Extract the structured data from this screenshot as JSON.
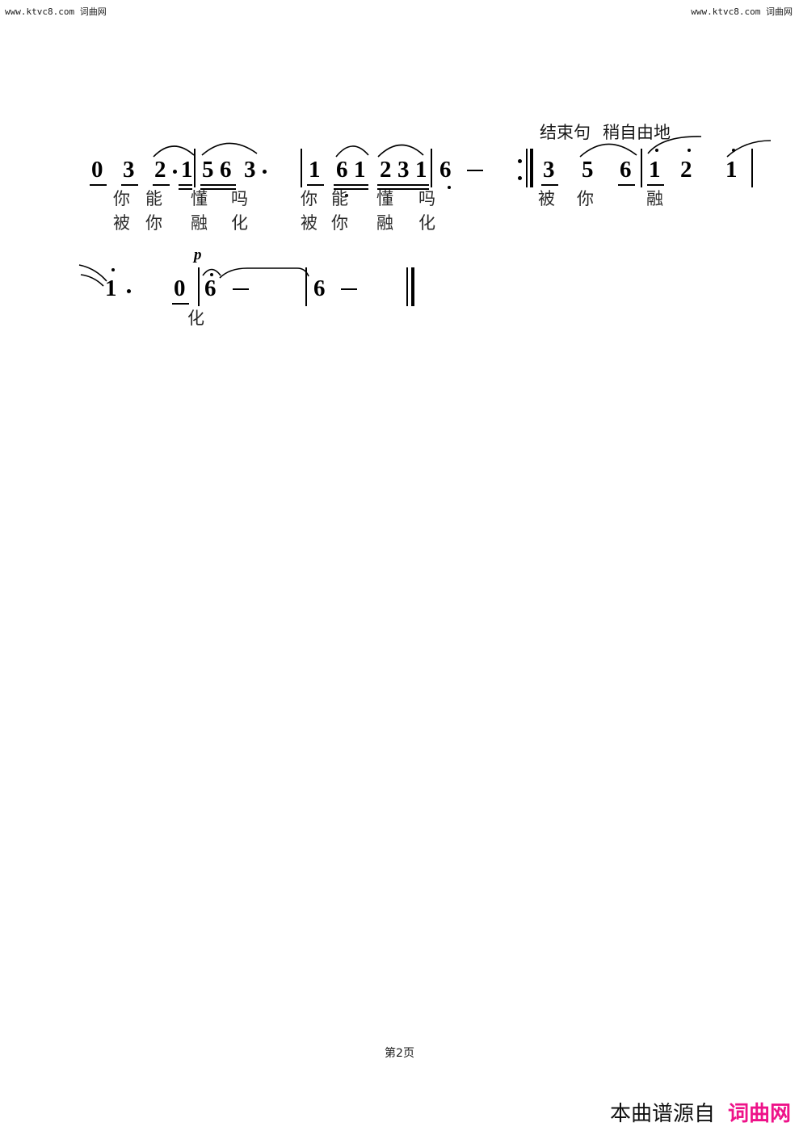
{
  "watermark": {
    "url": "www.ktvc8.com",
    "site": "词曲网",
    "left_text": "www.ktvc8.com 词曲网",
    "right_text": "www.ktvc8.com 词曲网"
  },
  "footer": {
    "page_number": "第2页",
    "source_label": "本曲谱源自",
    "source_site": "词曲网",
    "source_site_color": "#EE1289"
  },
  "annotations": {
    "ending_phrase": "结束句",
    "tempo_direction": "稍自由地",
    "dynamic_p": "p"
  },
  "chart_data": {
    "type": "table",
    "title": "简谱 第2页 (Jianpu numbered musical notation, page 2)",
    "notation": "jianpu",
    "systems": [
      {
        "index": 1,
        "measures": [
          {
            "index": 1,
            "notes": [
              {
                "pitch": "0",
                "beams": 1,
                "octave": 0,
                "dotted": false
              },
              {
                "pitch": "3",
                "beams": 1,
                "octave": 0,
                "dotted": false
              },
              {
                "pitch": "2",
                "beams": 1,
                "octave": 0,
                "dotted": true
              },
              {
                "pitch": "1",
                "beams": 2,
                "octave": 0,
                "dotted": false
              }
            ],
            "slurs": [
              "2-1"
            ],
            "lyrics_line1": [
              "你",
              "能"
            ],
            "lyrics_line2": [
              "被",
              "你"
            ]
          },
          {
            "index": 2,
            "notes": [
              {
                "pitch": "5",
                "beams": 2,
                "octave": 0,
                "dotted": false
              },
              {
                "pitch": "6",
                "beams": 2,
                "octave": 0,
                "dotted": false
              },
              {
                "pitch": "3",
                "beams": 0,
                "octave": 0,
                "dotted": true
              }
            ],
            "slurs": [
              "5-3"
            ],
            "lyrics_line1": [
              "懂",
              "吗"
            ],
            "lyrics_line2": [
              "融",
              "化"
            ]
          },
          {
            "index": 3,
            "notes": [
              {
                "pitch": "1",
                "beams": 1,
                "octave": 0,
                "dotted": false
              },
              {
                "pitch": "6",
                "beams": 2,
                "octave": -1,
                "dotted": false
              },
              {
                "pitch": "1",
                "beams": 2,
                "octave": 0,
                "dotted": false
              },
              {
                "pitch": "2",
                "beams": 2,
                "octave": 0,
                "dotted": false
              },
              {
                "pitch": "3",
                "beams": 2,
                "octave": 0,
                "dotted": false
              },
              {
                "pitch": "1",
                "beams": 2,
                "octave": 0,
                "dotted": false
              }
            ],
            "slurs": [
              "6-1",
              "2-1"
            ],
            "lyrics_line1": [
              "你",
              "能",
              "懂"
            ],
            "lyrics_line2": [
              "被",
              "你",
              "融"
            ]
          },
          {
            "index": 4,
            "notes": [
              {
                "pitch": "6",
                "beams": 0,
                "octave": -1,
                "dotted": false,
                "sustain": 1
              }
            ],
            "slurs": [],
            "lyrics_line1": [
              "吗"
            ],
            "lyrics_line2": [
              "化"
            ]
          },
          {
            "index": 5,
            "repeat_start": true,
            "notes": [
              {
                "pitch": "3",
                "beams": 1,
                "octave": 0,
                "dotted": false
              },
              {
                "pitch": "5",
                "beams": 0,
                "octave": 0,
                "dotted": false
              },
              {
                "pitch": "6",
                "beams": 1,
                "octave": 0,
                "dotted": false
              }
            ],
            "slurs": [
              "5-6"
            ],
            "lyrics_line1": [],
            "lyrics_line2": [
              "被",
              "你"
            ]
          },
          {
            "index": 6,
            "notes": [
              {
                "pitch": "1",
                "beams": 1,
                "octave": 1,
                "dotted": false
              },
              {
                "pitch": "2",
                "beams": 0,
                "octave": 1,
                "dotted": false
              },
              {
                "pitch": "1",
                "beams": 0,
                "octave": 1,
                "dotted": false
              }
            ],
            "slurs": [
              "1-2",
              "1-tie"
            ],
            "lyrics_line1": [],
            "lyrics_line2": [
              "融"
            ]
          }
        ]
      },
      {
        "index": 2,
        "measures": [
          {
            "index": 7,
            "notes": [
              {
                "pitch": "1",
                "beams": 0,
                "octave": 1,
                "dotted": true,
                "tied_from_previous": true
              },
              {
                "pitch": "0",
                "beams": 1,
                "octave": 0,
                "dotted": false
              }
            ],
            "slurs": [],
            "lyrics_line1": [],
            "lyrics_line2": []
          },
          {
            "index": 8,
            "notes": [
              {
                "pitch": "6",
                "beams": 0,
                "octave": 0,
                "dotted": false,
                "fermata": true,
                "sustain": 1,
                "tie_to_next": true
              }
            ],
            "dynamic": "p",
            "slurs": [],
            "lyrics_line1": [],
            "lyrics_line2": [
              "化"
            ]
          },
          {
            "index": 9,
            "notes": [
              {
                "pitch": "6",
                "beams": 0,
                "octave": 0,
                "dotted": false,
                "sustain": 1
              }
            ],
            "slurs": [],
            "final_barline": true,
            "lyrics_line1": [],
            "lyrics_line2": []
          }
        ]
      }
    ],
    "lyrics_full_line1": "你能懂吗  你能懂吗",
    "lyrics_full_line2": "被你融化  被你融化    被你融  化"
  },
  "glyphs": {
    "note_0": "0",
    "note_1": "1",
    "note_2": "2",
    "note_3": "3",
    "note_5": "5",
    "note_6": "6",
    "sustain_dash": "–",
    "aug_dot": "·"
  },
  "lyrics": {
    "m1_l1a": "你",
    "m1_l1b": "能",
    "m1_l2a": "被",
    "m1_l2b": "你",
    "m2_l1a": "懂",
    "m2_l1b": "吗",
    "m2_l2a": "融",
    "m2_l2b": "化",
    "m3_l1a": "你",
    "m3_l1b": "能",
    "m3_l1c": "懂",
    "m3_l2a": "被",
    "m3_l2b": "你",
    "m3_l2c": "融",
    "m4_l1a": "吗",
    "m4_l2a": "化",
    "end_l2a": "被",
    "end_l2b": "你",
    "end_l2c": "融",
    "line2_hua": "化"
  }
}
